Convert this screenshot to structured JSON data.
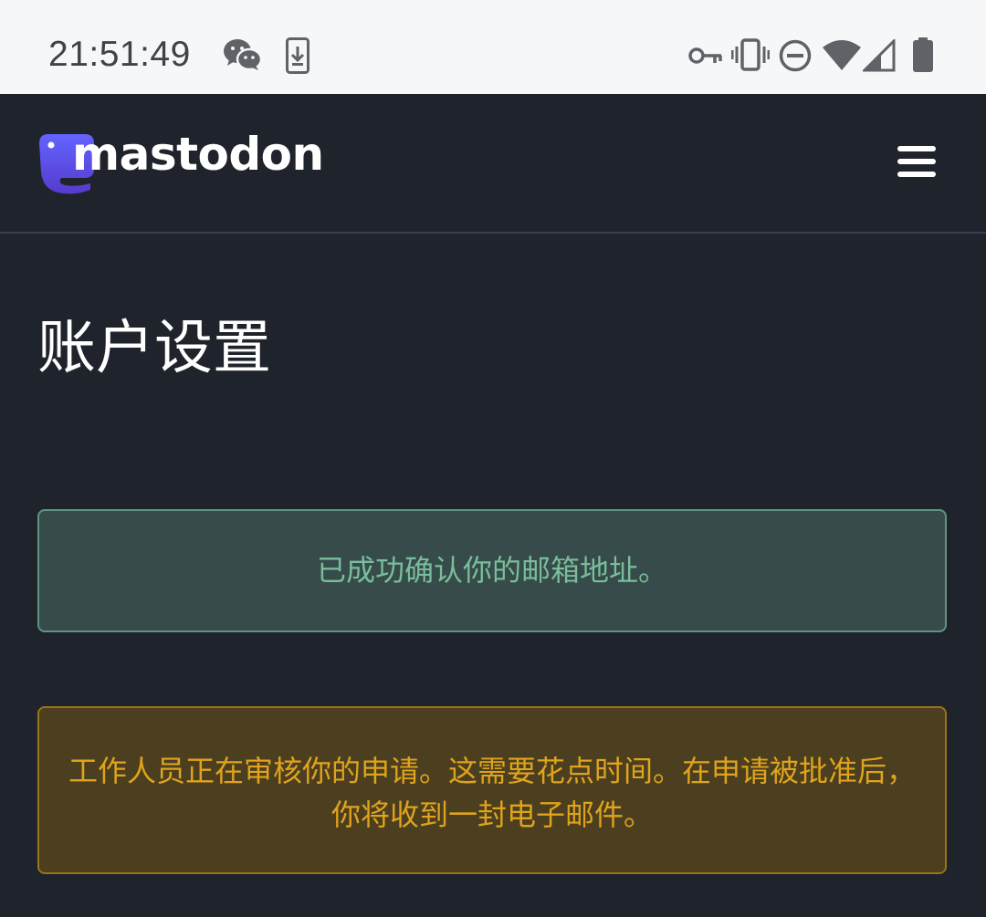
{
  "status_bar": {
    "time": "21:51:49",
    "icons": [
      "wechat-icon",
      "download-icon",
      "key-icon",
      "vibrate-icon",
      "do-not-disturb-icon",
      "wifi-icon",
      "signal-icon",
      "battery-icon"
    ]
  },
  "header": {
    "brand": "mastodon",
    "menu_icon": "hamburger-menu-icon"
  },
  "main": {
    "title": "账户设置",
    "notice": "已成功确认你的邮箱地址。",
    "alert": "工作人员正在审核你的申请。这需要花点时间。在申请被批准后，你将收到一封电子邮件。"
  },
  "colors": {
    "background": "#1f232b",
    "brand_purple": "#6364ff",
    "notice_text": "#79bd9a",
    "alert_text": "#e0a31b"
  }
}
